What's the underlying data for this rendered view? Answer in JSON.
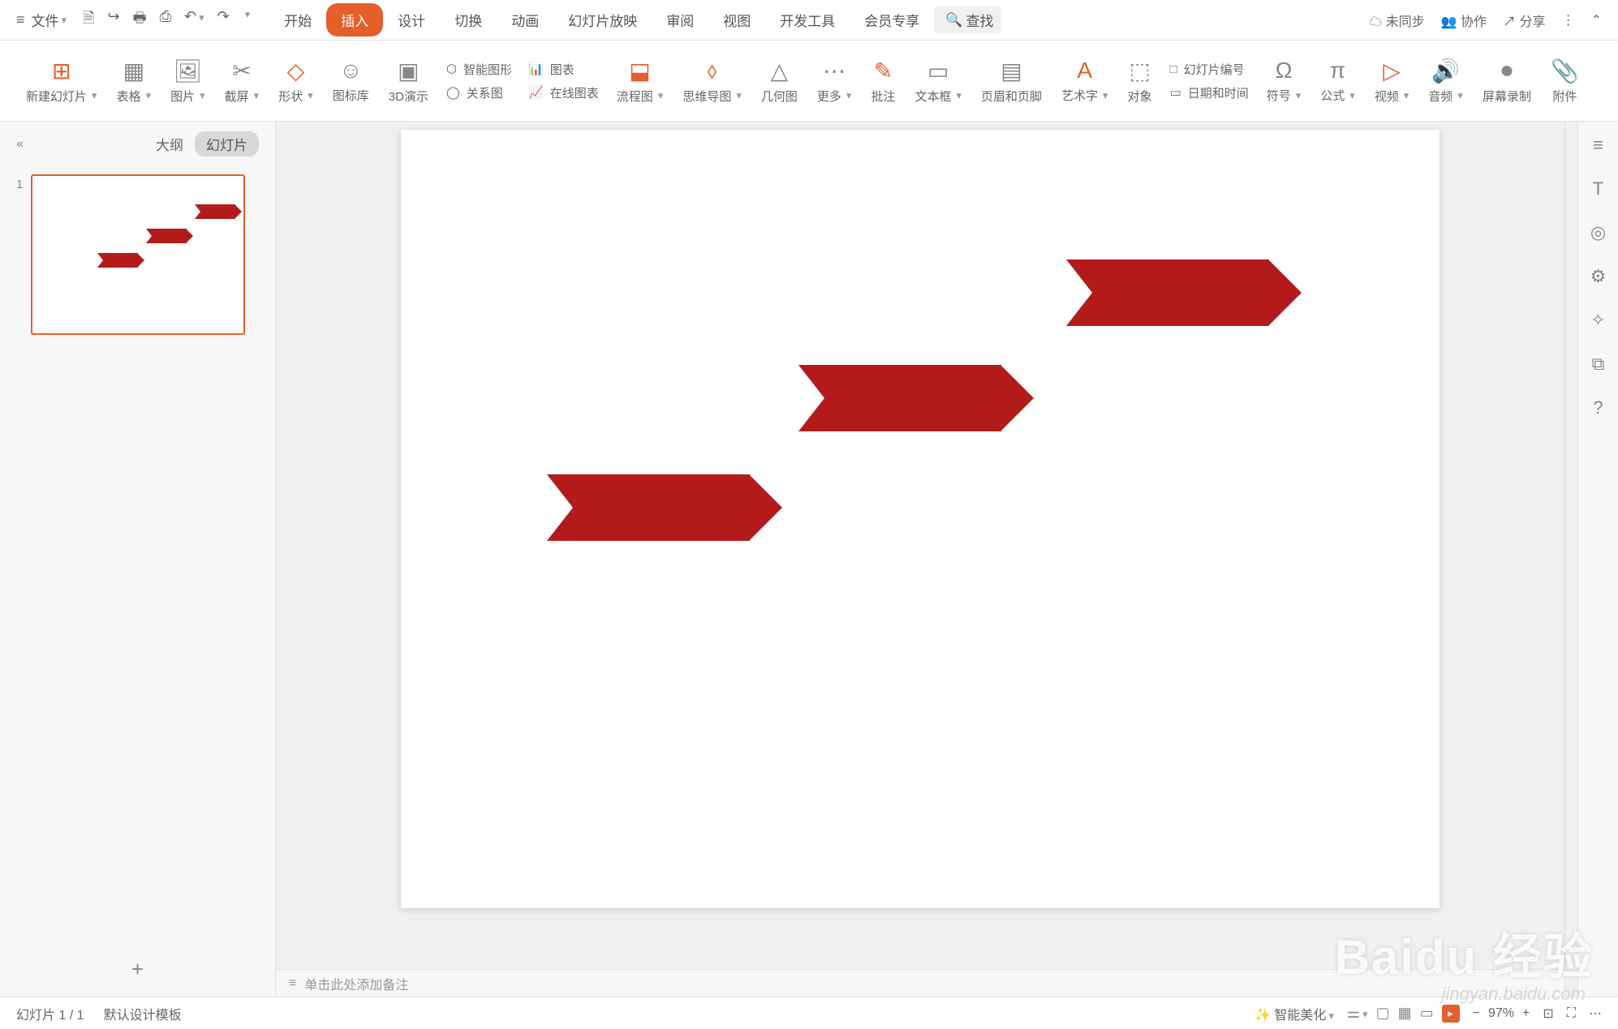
{
  "file_menu": "文件",
  "tabs": [
    "开始",
    "插入",
    "设计",
    "切换",
    "动画",
    "幻灯片放映",
    "审阅",
    "视图",
    "开发工具",
    "会员专享"
  ],
  "active_tab_index": 1,
  "search_label": "查找",
  "top_right": {
    "sync": "未同步",
    "collab": "协作",
    "share": "分享"
  },
  "ribbon": {
    "new_slide": "新建幻灯片",
    "table": "表格",
    "picture": "图片",
    "screenshot": "截屏",
    "shapes": "形状",
    "icon_lib": "图标库",
    "three_d": "3D演示",
    "smart_graphic": "智能图形",
    "chart": "图表",
    "relation": "关系图",
    "online_chart": "在线图表",
    "flowchart": "流程图",
    "mindmap": "思维导图",
    "geometry": "几何图",
    "more": "更多",
    "comment": "批注",
    "textbox": "文本框",
    "header_footer": "页眉和页脚",
    "wordart": "艺术字",
    "object": "对象",
    "slide_number": "幻灯片编号",
    "date_time": "日期和时间",
    "symbol": "符号",
    "equation": "公式",
    "video": "视频",
    "audio": "音频",
    "screen_rec": "屏幕录制",
    "attach": "附件"
  },
  "side": {
    "outline": "大纲",
    "slides": "幻灯片",
    "thumb_num": "1"
  },
  "notes_placeholder": "单击此处添加备注",
  "status": {
    "page": "幻灯片 1 / 1",
    "template": "默认设计模板",
    "beautify": "智能美化",
    "zoom": "97%"
  },
  "right_rail_icons": [
    "text-icon",
    "idea-icon",
    "settings-icon",
    "magic-icon",
    "duplicate-icon",
    "help-icon"
  ],
  "watermark": "Baidu 经验",
  "watermark_sub": "jingyan.baidu.com"
}
